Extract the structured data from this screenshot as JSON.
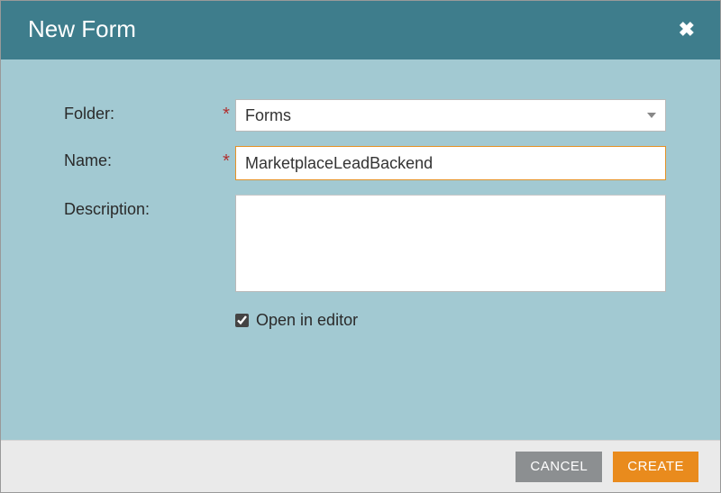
{
  "header": {
    "title": "New Form"
  },
  "form": {
    "folder_label": "Folder:",
    "folder_value": "Forms",
    "name_label": "Name:",
    "name_value": "MarketplaceLeadBackend",
    "description_label": "Description:",
    "description_value": "",
    "open_in_editor_label": "Open in editor",
    "open_in_editor_checked": true
  },
  "actions": {
    "cancel": "CANCEL",
    "create": "CREATE"
  }
}
